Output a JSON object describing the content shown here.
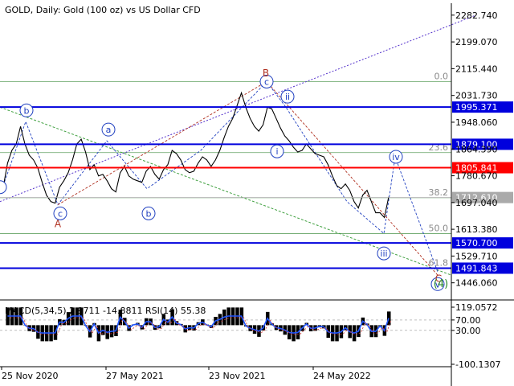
{
  "header": {
    "title": "GOLD, Daily:  Gold (100 oz) vs US Dollar CFD",
    "indicator_label": "MACD(5,34,5) 2.9711 -14.8811 RSI(14) 55.38"
  },
  "chart_data": {
    "type": "line",
    "title": "GOLD, Daily:  Gold (100 oz) vs US Dollar CFD",
    "symbol": "GOLD",
    "timeframe": "Daily",
    "price_axis": {
      "range": [
        1400,
        2320
      ],
      "ticks": [
        "2282.740",
        "2199.070",
        "2115.440",
        "2031.730",
        "1948.060",
        "1864.390",
        "1780.670",
        "1697.040",
        "1613.380",
        "1529.710",
        "1446.060"
      ]
    },
    "time_axis": {
      "labels": [
        "25 Nov 2020",
        "27 May 2021",
        "23 Nov 2021",
        "24 May 2022"
      ]
    },
    "price_series": [
      1745,
      1820,
      1860,
      1880,
      1935,
      1880,
      1845,
      1830,
      1805,
      1760,
      1720,
      1700,
      1695,
      1745,
      1765,
      1790,
      1830,
      1880,
      1895,
      1855,
      1800,
      1815,
      1780,
      1785,
      1765,
      1740,
      1730,
      1790,
      1810,
      1780,
      1770,
      1765,
      1760,
      1795,
      1810,
      1785,
      1770,
      1800,
      1815,
      1860,
      1850,
      1830,
      1800,
      1790,
      1795,
      1820,
      1840,
      1830,
      1810,
      1830,
      1860,
      1900,
      1935,
      1960,
      2000,
      2040,
      1995,
      1960,
      1935,
      1920,
      1940,
      1995,
      1990,
      1960,
      1930,
      1905,
      1890,
      1870,
      1855,
      1860,
      1880,
      1865,
      1850,
      1845,
      1840,
      1815,
      1780,
      1750,
      1740,
      1755,
      1735,
      1700,
      1680,
      1720,
      1735,
      1700,
      1665,
      1665,
      1650,
      1715
    ],
    "horizontal_levels": [
      {
        "price": "1995.371",
        "color": "#0000dd"
      },
      {
        "price": "1879.100",
        "color": "#0000dd"
      },
      {
        "price": "1805.841",
        "color": "#ff0000"
      },
      {
        "price": "1712.610",
        "color": "#aaaaaa"
      },
      {
        "price": "1570.700",
        "color": "#0000dd"
      },
      {
        "price": "1491.843",
        "color": "#0000dd"
      }
    ],
    "fibonacci_levels": [
      {
        "label": "0.0",
        "price": 2075
      },
      {
        "label": "23.6",
        "price": 1853
      },
      {
        "label": "38.2",
        "price": 1712
      },
      {
        "label": "50.0",
        "price": 1600
      },
      {
        "label": "61.8",
        "price": 1492
      }
    ],
    "wave_labels": {
      "circled": [
        "b",
        "a",
        "c",
        "b",
        "c",
        "ii",
        "i",
        "iv",
        "iii",
        "v"
      ],
      "plain": [
        "B",
        "A",
        "C"
      ],
      "correction_label": "(4)"
    },
    "indicator": {
      "name": "MACD(5,34,5) 2.9711 -14.8811 RSI(14) 55.38",
      "macd": 2.9711,
      "signal": -14.8811,
      "rsi": 55.38,
      "range": [
        -100.1307,
        119.0572
      ],
      "ticks": [
        "119.0572",
        "70.00",
        "30.00",
        "-100.1307"
      ]
    },
    "colors": {
      "level_blue": "#0000dd",
      "level_red": "#ff0000",
      "fib_green": "#3a8a3a",
      "trend_purple": "#5533cc",
      "wave_blue": "#2040c0",
      "wave_red": "#b03020",
      "rsi_line": "#2255ff"
    },
    "grid": true
  }
}
